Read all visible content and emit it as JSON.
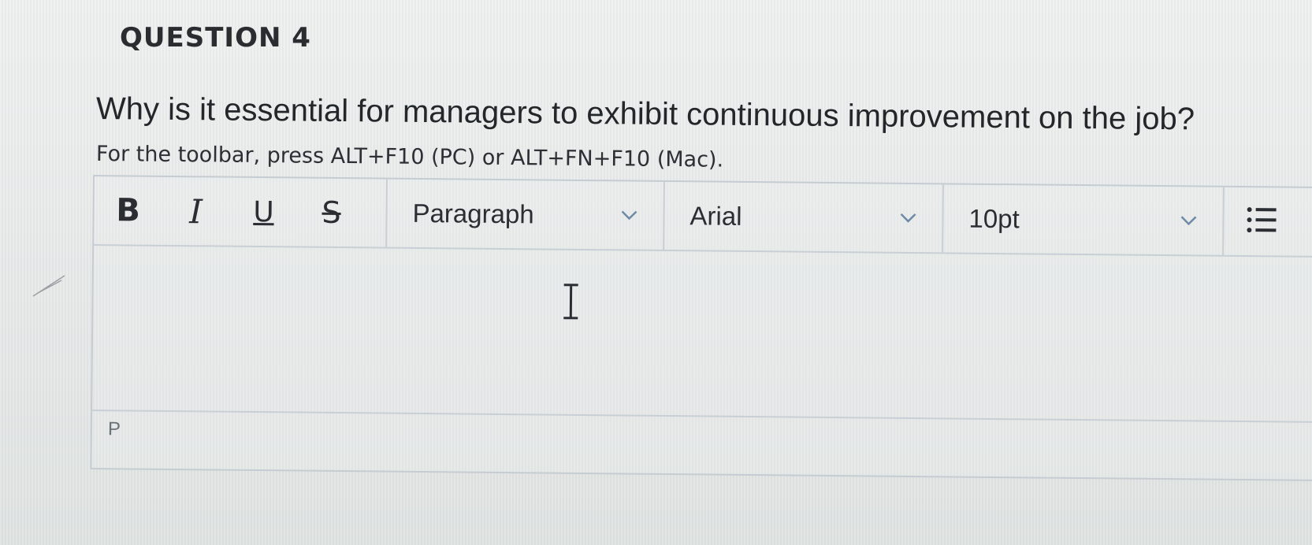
{
  "question": {
    "title": "QUESTION 4",
    "text": "Why is it essential for managers to exhibit continuous improvement on the job?",
    "toolbar_hint": "For the toolbar, press ALT+F10 (PC) or ALT+FN+F10 (Mac)."
  },
  "toolbar": {
    "bold_label": "B",
    "italic_label": "I",
    "underline_label": "U",
    "strikethrough_label": "S",
    "block_format": "Paragraph",
    "font_family": "Arial",
    "font_size": "10pt",
    "list_icon": "list-icon"
  },
  "editor": {
    "content": "",
    "status_path": "P"
  },
  "colors": {
    "background": "#e3e7e6",
    "text": "#25282b",
    "border": "#c8cfd5",
    "chevron": "#6f8aa6",
    "muted": "#6b7278"
  }
}
